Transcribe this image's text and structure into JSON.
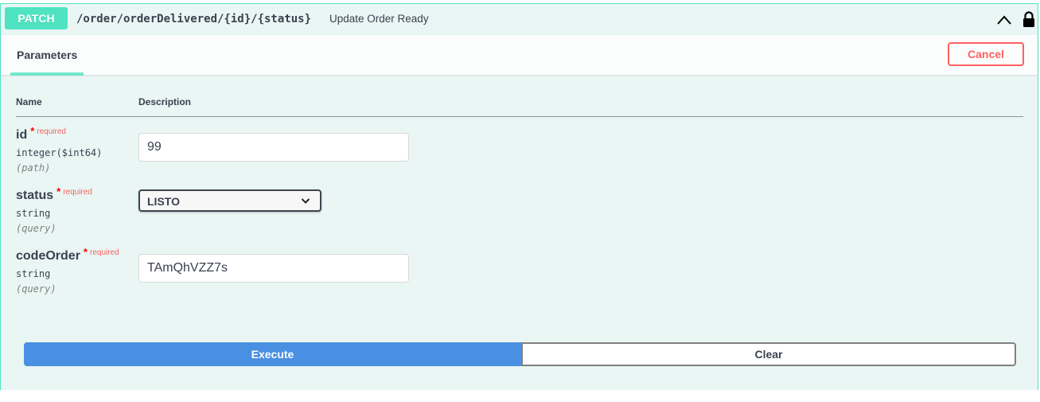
{
  "endpoint": {
    "method": "PATCH",
    "path": "/order/orderDelivered/{id}/{status}",
    "summary": "Update Order Ready",
    "method_color": "#50e3c2",
    "icons": {
      "collapse": "chevron-up-icon",
      "auth": "lock-icon"
    }
  },
  "section": {
    "tab_label": "Parameters",
    "cancel_label": "Cancel"
  },
  "table": {
    "columns": [
      "Name",
      "Description"
    ]
  },
  "parameters": [
    {
      "name": "id",
      "required_marker": "*",
      "required_text": "required",
      "type": "integer($int64)",
      "in": "(path)",
      "value": "99"
    },
    {
      "name": "status",
      "required_marker": "*",
      "required_text": "required",
      "type": "string",
      "in": "(query)",
      "selected": "LISTO"
    },
    {
      "name": "codeOrder",
      "required_marker": "*",
      "required_text": "required",
      "type": "string",
      "in": "(query)",
      "value": "TAmQhVZZ7s"
    }
  ],
  "actions": {
    "execute_label": "Execute",
    "clear_label": "Clear",
    "execute_color": "#4990e2"
  }
}
